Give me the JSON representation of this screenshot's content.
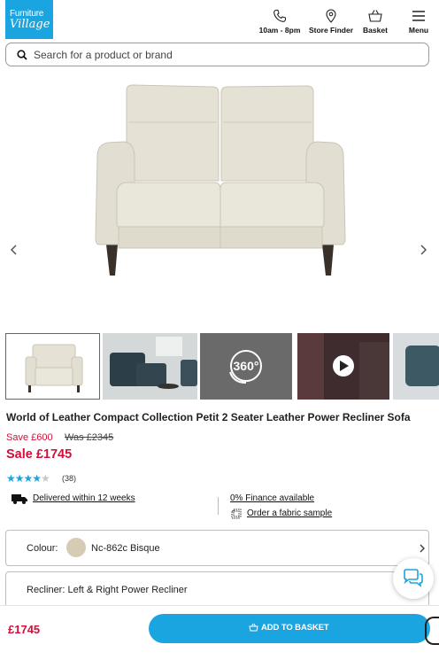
{
  "header": {
    "logo_line1": "Furniture",
    "logo_line2": "Village",
    "hours_label": "10am - 8pm",
    "store_finder_label": "Store Finder",
    "basket_label": "Basket",
    "menu_label": "Menu"
  },
  "search": {
    "placeholder": "Search for a product or brand"
  },
  "gallery": {
    "thumb3_badge": "360°"
  },
  "product": {
    "title": "World of Leather Compact Collection Petit 2 Seater Leather Power Recliner Sofa",
    "save": "Save £600",
    "was": "Was £2345",
    "sale": "Sale £1745",
    "rating_stars": 4,
    "reviews": "(38)"
  },
  "features": {
    "delivery": "Delivered within 12 weeks",
    "finance": "0% Finance available",
    "sample": "Order a fabric sample"
  },
  "options": {
    "colour_key": "Colour:",
    "colour_value": "Nc-862c Bisque",
    "colour_swatch": "#d6ccb6",
    "recliner": "Recliner: Left & Right Power Recliner"
  },
  "bottom_bar": {
    "price": "£1745",
    "add_label": "ADD TO BASKET"
  },
  "colors": {
    "brand_blue": "#1aa5e0",
    "sale_red": "#d0103a"
  }
}
